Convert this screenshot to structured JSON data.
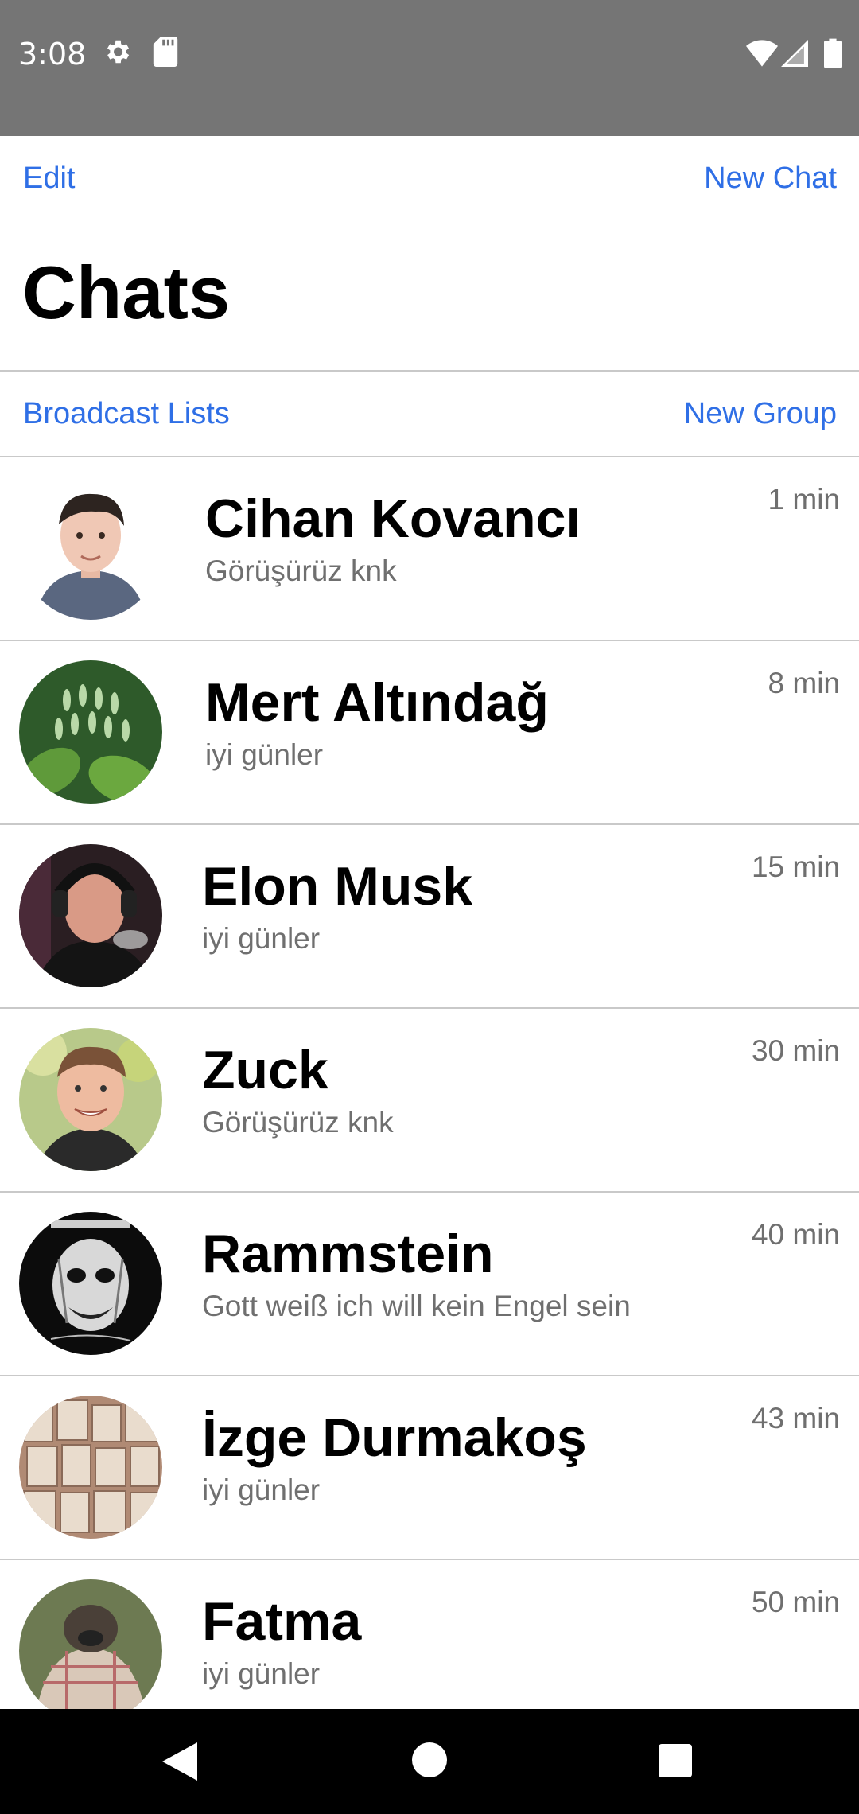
{
  "status_bar": {
    "time": "3:08",
    "icons": [
      "gear-icon",
      "sd-card-icon",
      "wifi-icon",
      "signal-icon",
      "battery-icon"
    ]
  },
  "header": {
    "edit_label": "Edit",
    "new_chat_label": "New Chat",
    "title": "Chats"
  },
  "subheader": {
    "broadcast_label": "Broadcast Lists",
    "new_group_label": "New Group"
  },
  "chats": [
    {
      "name": "Cihan Kovancı",
      "message": "Görüşürüz knk",
      "time": "1 min"
    },
    {
      "name": "Mert Altındağ",
      "message": "iyi günler",
      "time": "8 min"
    },
    {
      "name": "Elon Musk",
      "message": "iyi günler",
      "time": "15 min"
    },
    {
      "name": "Zuck",
      "message": "Görüşürüz knk",
      "time": "30 min"
    },
    {
      "name": "Rammstein",
      "message": "Gott weiß ich will kein Engel sein",
      "time": "40 min"
    },
    {
      "name": "İzge Durmakoş",
      "message": "iyi günler",
      "time": "43 min"
    },
    {
      "name": "Fatma",
      "message": "iyi günler",
      "time": "50 min"
    }
  ],
  "nav_bar": {
    "icons": [
      "back-icon",
      "home-icon",
      "recents-icon"
    ]
  },
  "colors": {
    "accent": "#2f6fe6",
    "status_bar": "#757575",
    "divider": "#c9c9c9",
    "secondary_text": "#6f6f6f"
  }
}
